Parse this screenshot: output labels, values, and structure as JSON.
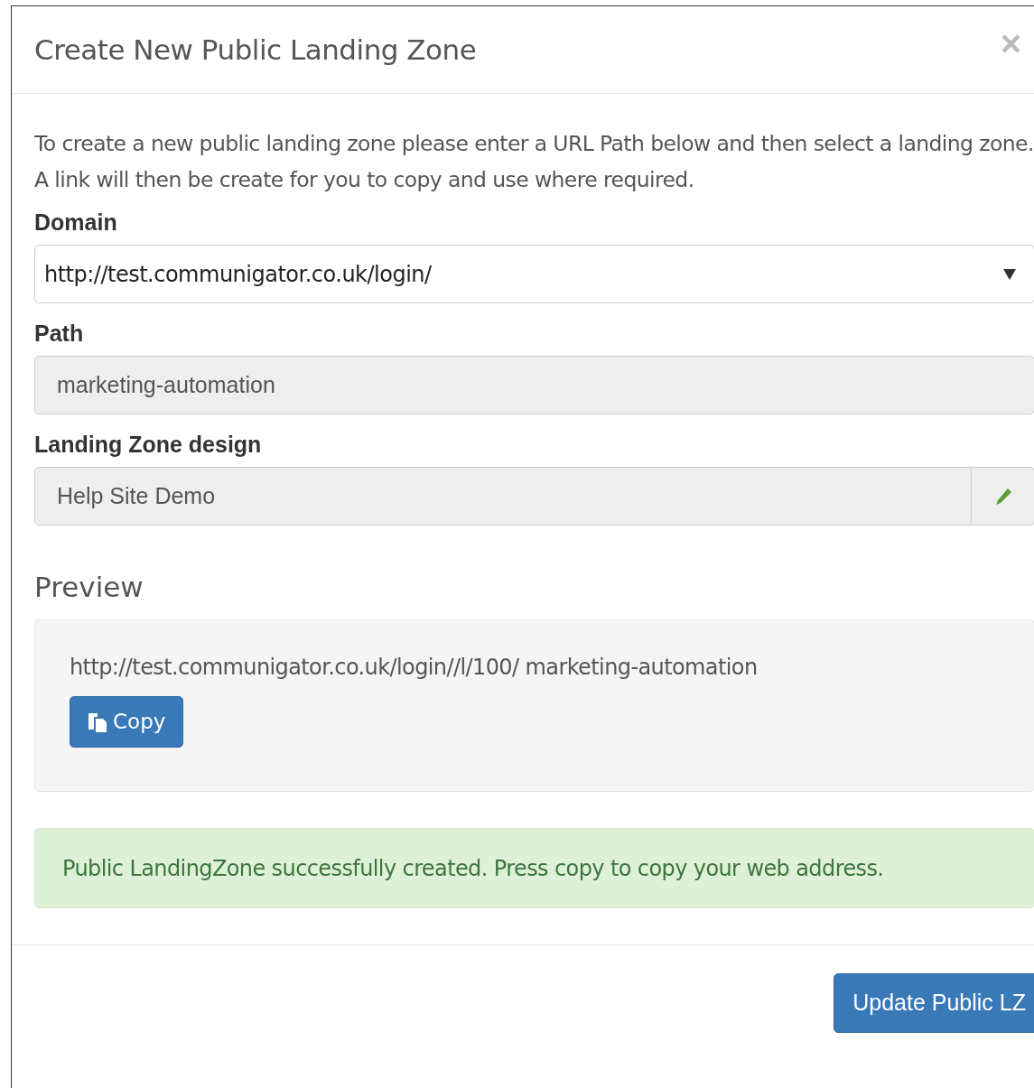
{
  "modal": {
    "title": "Create New Public Landing Zone",
    "close": "×"
  },
  "intro": "To create a new public landing zone please enter a URL Path below and then select a landing zone. A link will then be create for you to copy and use where required.",
  "fields": [
    {
      "kind": "select",
      "label": "Domain",
      "value": "http://test.communigator.co.uk/login/"
    },
    {
      "kind": "readonly",
      "label": "Path",
      "value": "marketing-automation"
    },
    {
      "kind": "editable",
      "label": "Landing Zone design",
      "value": "Help Site Demo"
    }
  ],
  "preview": {
    "heading": "Preview",
    "url": "http://test.communigator.co.uk/login//l/100/ marketing-automation",
    "copy_button": "Copy"
  },
  "alert": {
    "kind": "success",
    "text": "Public LandingZone successfully created. Press copy to copy your web address."
  },
  "footer": {
    "button": "Update Public LZ"
  }
}
